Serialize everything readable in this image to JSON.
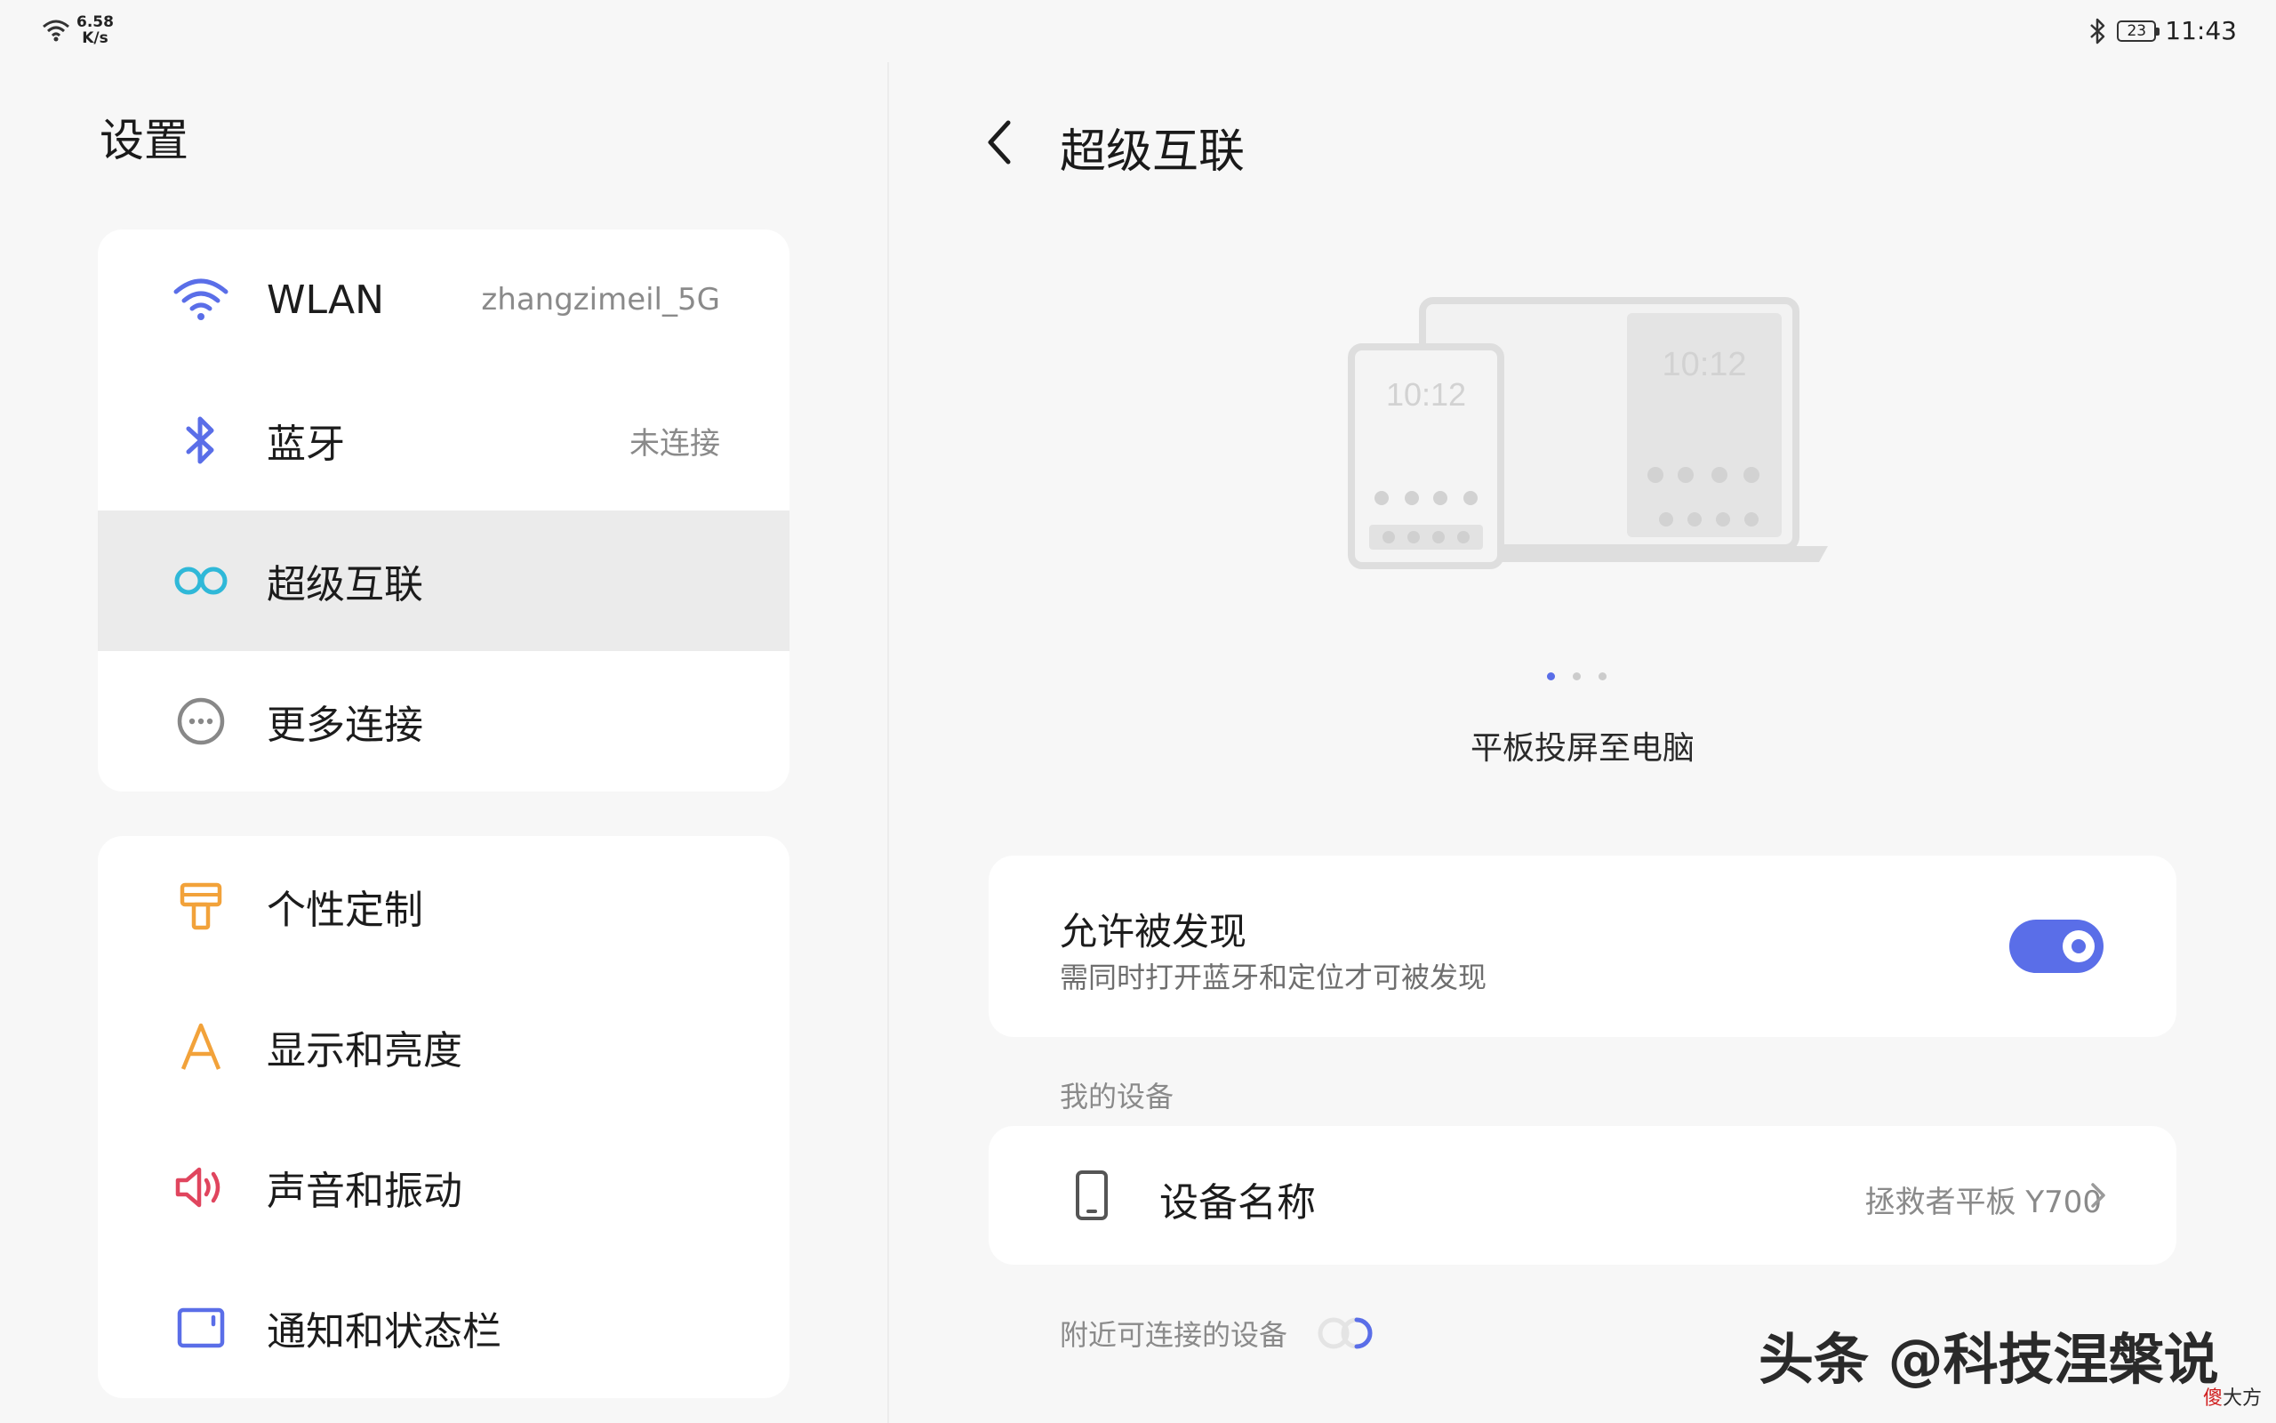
{
  "status_bar": {
    "net_speed_value": "6.58",
    "net_speed_unit": "K/s",
    "battery": "23",
    "time": "11:43"
  },
  "settings": {
    "title": "设置",
    "group1": [
      {
        "label": "WLAN",
        "value": "zhangzimeil_5G",
        "icon": "wifi-icon",
        "color": "#5a6ee8"
      },
      {
        "label": "蓝牙",
        "value": "未连接",
        "icon": "bluetooth-icon",
        "color": "#5a6ee8"
      },
      {
        "label": "超级互联",
        "value": "",
        "icon": "link-loop-icon",
        "color": "#2fb8d8",
        "selected": true
      },
      {
        "label": "更多连接",
        "value": "",
        "icon": "more-dots-icon",
        "color": "#888888"
      }
    ],
    "group2": [
      {
        "label": "个性定制",
        "icon": "paint-roller-icon",
        "color": "#f2a23a"
      },
      {
        "label": "显示和亮度",
        "icon": "letter-a-icon",
        "color": "#f2a23a"
      },
      {
        "label": "声音和振动",
        "icon": "speaker-icon",
        "color": "#e0455e"
      },
      {
        "label": "通知和状态栏",
        "icon": "notification-icon",
        "color": "#5a6ee8"
      }
    ]
  },
  "detail": {
    "title": "超级互联",
    "illustration_time_a": "10:12",
    "illustration_time_b": "10:12",
    "carousel_caption": "平板投屏至电脑",
    "carousel_page": 1,
    "carousel_total": 3,
    "discover": {
      "title": "允许被发现",
      "subtitle": "需同时打开蓝牙和定位才可被发现",
      "enabled": true
    },
    "my_devices_header": "我的设备",
    "device_name_label": "设备名称",
    "device_name_value": "拯救者平板 Y700",
    "nearby_header": "附近可连接的设备"
  },
  "watermark": {
    "text": "头条 @科技涅槃说",
    "small_red": "傻",
    "small_rest": "大方"
  },
  "colors": {
    "accent": "#5a6ee8",
    "background": "#f7f7f7",
    "card": "#ffffff",
    "selected_row": "#ebebeb"
  }
}
